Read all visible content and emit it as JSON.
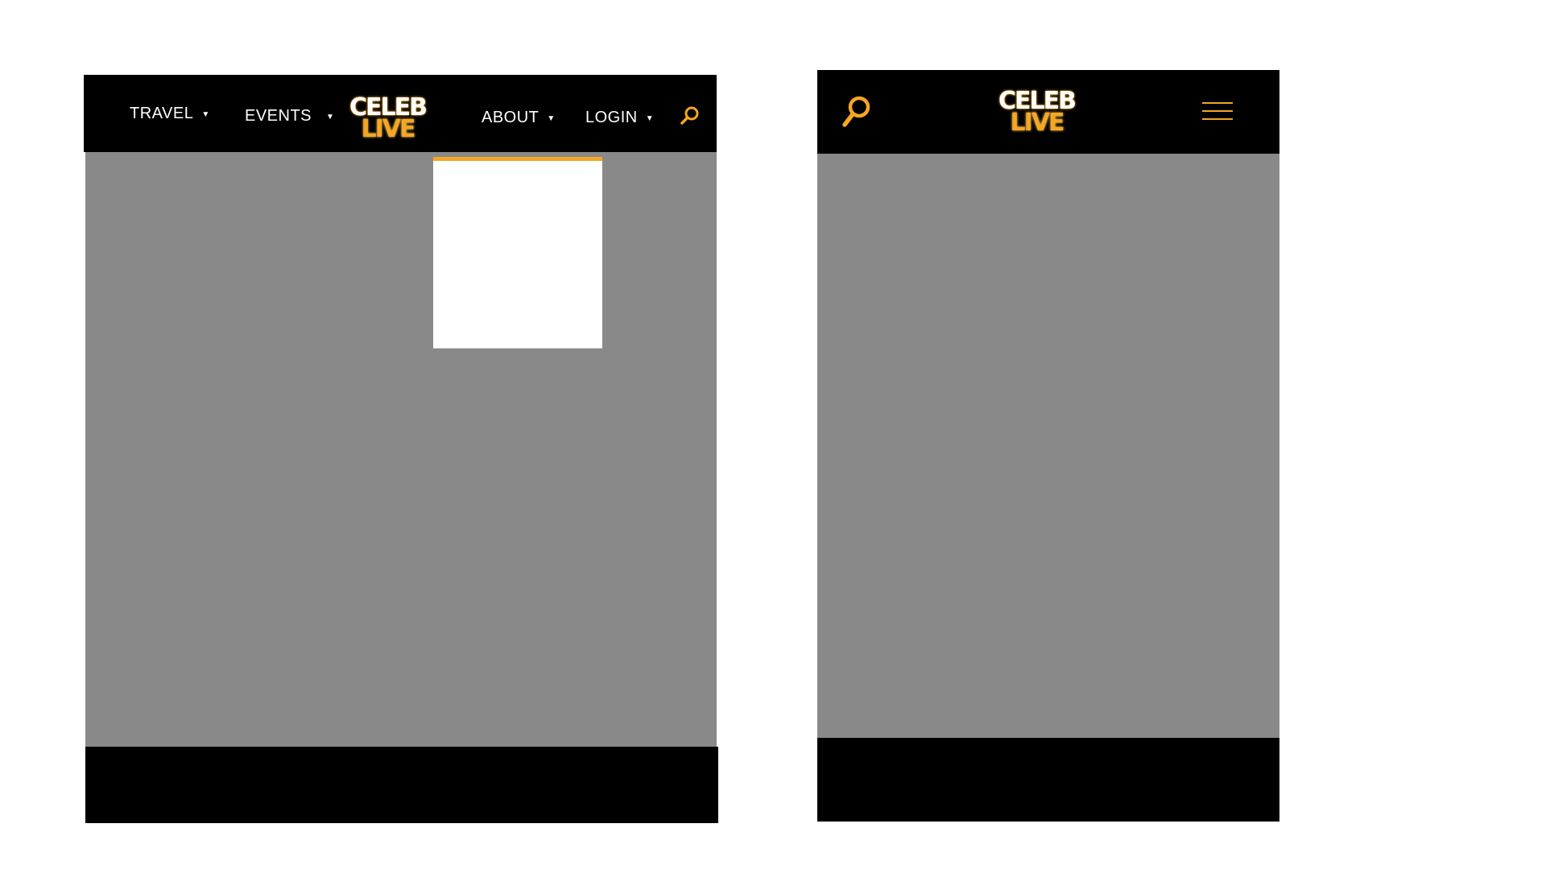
{
  "colors": {
    "accent": "#f5a623",
    "header": "#000000",
    "content_placeholder": "#898989",
    "dropdown": "#ffffff"
  },
  "brand": {
    "line1": "CELEB",
    "line2": "LIVE"
  },
  "desktop": {
    "nav": {
      "travel": "TRAVEL",
      "events": "EVENTS",
      "about": "ABOUT",
      "login": "LOGIN",
      "caret": "▼"
    },
    "icons": {
      "search": "search-icon",
      "caret": "chevron-down-icon"
    }
  },
  "mobile": {
    "icons": {
      "search": "search-icon",
      "menu": "hamburger-menu-icon"
    }
  }
}
